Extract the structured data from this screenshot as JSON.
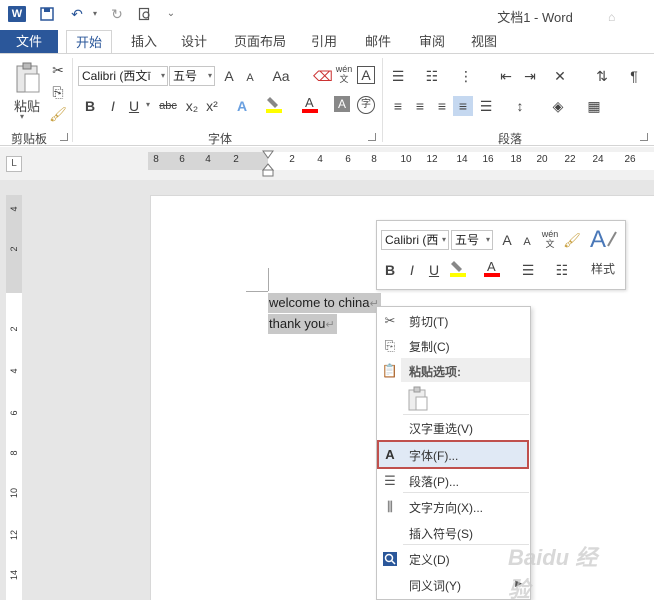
{
  "window": {
    "title": "文档1 - Word",
    "app_icon": "W"
  },
  "quick_access": {
    "save_icon": "save-icon",
    "undo_icon": "undo-icon",
    "redo_icon": "redo-icon",
    "preview_icon": "print-preview-icon"
  },
  "tabs": {
    "file": "文件",
    "home": "开始",
    "insert": "插入",
    "design": "设计",
    "layout": "页面布局",
    "references": "引用",
    "mailings": "邮件",
    "review": "审阅",
    "view": "视图"
  },
  "ribbon": {
    "paste": "粘贴",
    "clipboard_group": "剪贴板",
    "font_group": "字体",
    "paragraph_group": "段落",
    "font_name": "Calibri (西文ī",
    "font_size": "五号",
    "bold": "B",
    "italic": "I",
    "underline": "U",
    "strike": "abc",
    "subscript": "x₂",
    "superscript": "x²",
    "grow": "A",
    "shrink": "A",
    "case": "Aa",
    "phonetic": "wén 文",
    "border_char": "A",
    "text_effects": "A",
    "font_color": "A",
    "shading_char": "A",
    "enclosed": "字"
  },
  "ruler": {
    "top_numbers": [
      "8",
      "6",
      "4",
      "2",
      "2",
      "4",
      "6",
      "8",
      "10",
      "12",
      "14",
      "16",
      "18",
      "20",
      "22",
      "24",
      "26"
    ],
    "left_numbers": [
      "4",
      "2",
      "2",
      "4",
      "6",
      "8",
      "10",
      "12",
      "14"
    ],
    "tab_selector": "L"
  },
  "document": {
    "line1": "welcome to china",
    "line2": "thank you",
    "para_mark": "↵"
  },
  "mini_toolbar": {
    "font_name": "Calibri (西",
    "font_size": "五号",
    "bold": "B",
    "italic": "I",
    "underline": "U",
    "styles_label": "样式"
  },
  "context_menu": {
    "items": [
      {
        "label": "剪切(T)",
        "icon": "scissors-icon"
      },
      {
        "label": "复制(C)",
        "icon": "copy-icon"
      },
      {
        "label": "粘贴选项:",
        "icon": "paste-icon"
      },
      {
        "label": "汉字重选(V)",
        "icon": ""
      },
      {
        "label": "字体(F)...",
        "icon": "font-icon"
      },
      {
        "label": "段落(P)...",
        "icon": "paragraph-icon"
      },
      {
        "label": "文字方向(X)...",
        "icon": "text-direction-icon"
      },
      {
        "label": "插入符号(S)",
        "icon": ""
      },
      {
        "label": "定义(D)",
        "icon": "define-icon"
      },
      {
        "label": "同义词(Y)",
        "icon": ""
      }
    ],
    "highlight_color": "#c0504d"
  },
  "colors": {
    "accent": "#2b579a",
    "highlight_yellow": "#ffff00",
    "font_red": "#ff0000"
  },
  "watermark": "Baidu 经验"
}
